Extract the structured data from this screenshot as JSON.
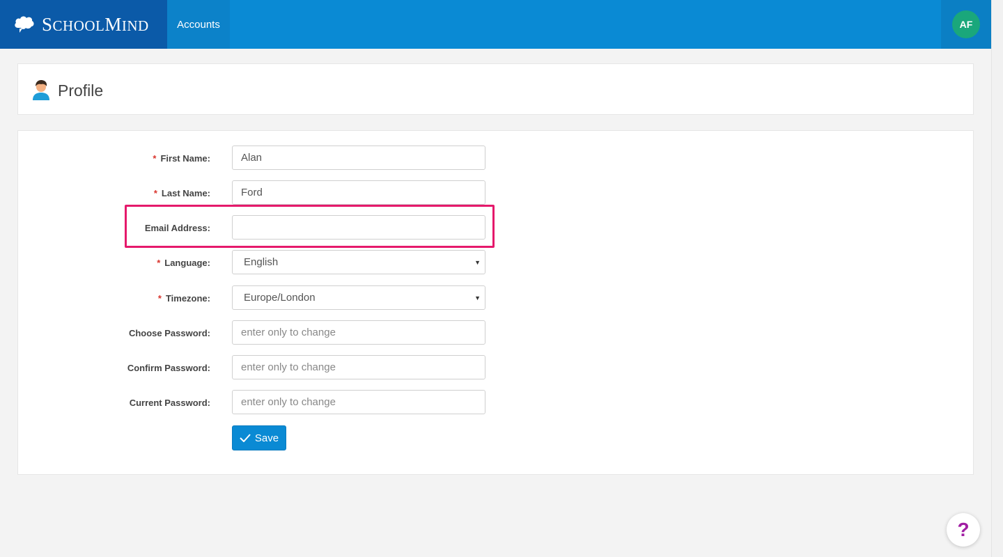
{
  "header": {
    "brand_first": "S",
    "brand_rest": "CHOOL",
    "brand_second": "M",
    "brand_second_rest": "IND",
    "nav_accounts": "Accounts",
    "avatar_initials": "AF"
  },
  "page": {
    "title": "Profile"
  },
  "form": {
    "first_name": {
      "label": "First Name:",
      "required": "*",
      "value": "Alan"
    },
    "last_name": {
      "label": "Last Name:",
      "required": "*",
      "value": "Ford"
    },
    "email": {
      "label": "Email Address:",
      "value": ""
    },
    "language": {
      "label": "Language:",
      "required": "*",
      "value": "English"
    },
    "timezone": {
      "label": "Timezone:",
      "required": "*",
      "value": "Europe/London"
    },
    "choose_password": {
      "label": "Choose Password:",
      "placeholder": "enter only to change"
    },
    "confirm_password": {
      "label": "Confirm Password:",
      "placeholder": "enter only to change"
    },
    "current_password": {
      "label": "Current Password:",
      "placeholder": "enter only to change"
    },
    "save_label": "Save"
  },
  "help": {
    "label": "?"
  },
  "colors": {
    "header": "#0a8ad4",
    "brand_bg": "#0b5aa8",
    "avatar": "#1aa77b",
    "highlight": "#e5196b",
    "required": "#d9352d",
    "help_icon": "#a11ea3"
  }
}
